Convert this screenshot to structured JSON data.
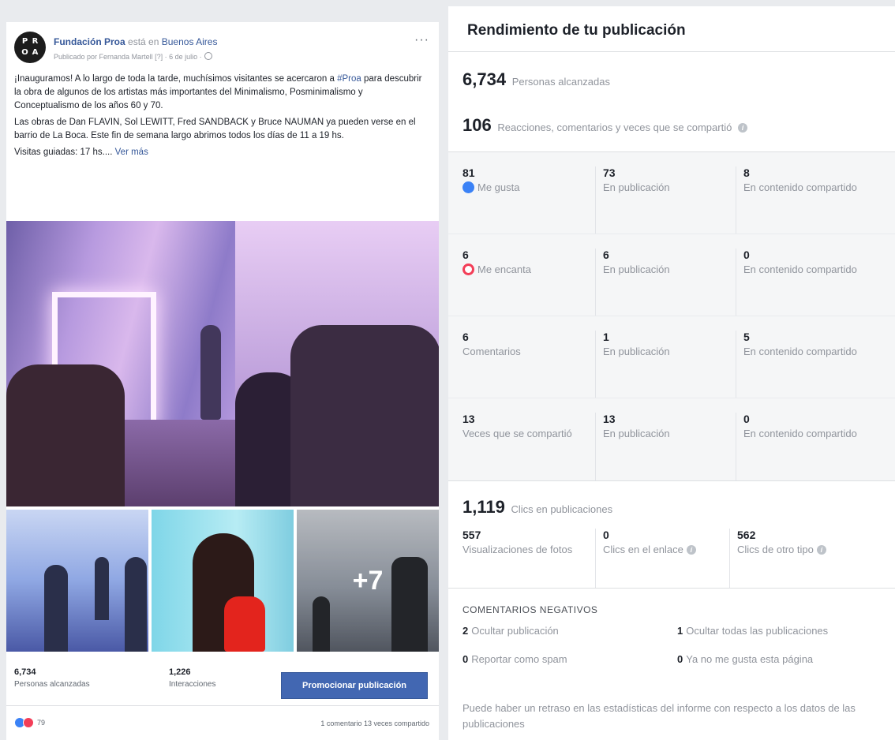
{
  "post": {
    "avatar_text": [
      "P",
      "R",
      "O",
      "A"
    ],
    "page_name": "Fundación Proa",
    "location_prefix": "está en",
    "location": "Buenos Aires",
    "byline": "Publicado por Fernanda Martell [?] · 6 de julio ·",
    "more_label": "···",
    "paragraph_1_a": "¡Inauguramos! A lo largo de toda la tarde, muchísimos visitantes se acercaron a ",
    "hashtag": "#Proa",
    "paragraph_1_b": " para descubrir la obra de algunos de los artistas más importantes del Minimalismo, Posminimalismo y Conceptualismo de los años 60 y 70.",
    "paragraph_2": "Las obras de Dan FLAVIN, Sol LEWITT, Fred SANDBACK y Bruce NAUMAN ya pueden verse en el barrio de La Boca. Este fin de semana largo abrimos todos los días de 11 a 19 hs.",
    "paragraph_3": "Visitas guiadas: 17 hs.... ",
    "see_more": "Ver más",
    "more_photos": "+7",
    "reach_value": "6,734",
    "reach_label": "Personas alcanzadas",
    "interactions_value": "1,226",
    "interactions_label": "Interacciones",
    "promote_label": "Promocionar publicación",
    "reaction_count": "79",
    "footer_counts": "1 comentario   13 veces compartido"
  },
  "panel": {
    "title": "Rendimiento de tu publicación",
    "reach_value": "6,734",
    "reach_label": "Personas alcanzadas",
    "engagement_value": "106",
    "engagement_label": "Reacciones, comentarios y veces que se compartió",
    "rows": [
      {
        "total": "81",
        "label": "Me gusta",
        "icon": "like-icon",
        "on_post": "73",
        "on_post_label": "En publicación",
        "on_shares": "8",
        "on_shares_label": "En contenido compartido"
      },
      {
        "total": "6",
        "label": "Me encanta",
        "icon": "love-icon",
        "on_post": "6",
        "on_post_label": "En publicación",
        "on_shares": "0",
        "on_shares_label": "En contenido compartido"
      },
      {
        "total": "6",
        "label": "Comentarios",
        "icon": "",
        "on_post": "1",
        "on_post_label": "En publicación",
        "on_shares": "5",
        "on_shares_label": "En contenido compartido"
      },
      {
        "total": "13",
        "label": "Veces que se compartió",
        "icon": "",
        "on_post": "13",
        "on_post_label": "En publicación",
        "on_shares": "0",
        "on_shares_label": "En contenido compartido"
      }
    ],
    "clicks_value": "1,119",
    "clicks_label": "Clics en publicaciones",
    "clicks": [
      {
        "value": "557",
        "label": "Visualizaciones de fotos"
      },
      {
        "value": "0",
        "label": "Clics en el enlace"
      },
      {
        "value": "562",
        "label": "Clics de otro tipo"
      }
    ],
    "negative_title": "COMENTARIOS NEGATIVOS",
    "negative": [
      {
        "value": "2",
        "label": "Ocultar publicación"
      },
      {
        "value": "1",
        "label": "Ocultar todas las publicaciones"
      },
      {
        "value": "0",
        "label": "Reportar como spam"
      },
      {
        "value": "0",
        "label": "Ya no me gusta esta página"
      }
    ],
    "disclaimer": "Puede haber un retraso en las estadísticas del informe con respecto a los datos de las publicaciones",
    "info_glyph": "i"
  },
  "colors": {
    "facebook_blue": "#4267b2",
    "link_blue": "#365899",
    "like_blue": "#3b82f6",
    "love_red": "#f33e58",
    "muted_text": "#90949c",
    "page_bg": "#e9ebee"
  }
}
